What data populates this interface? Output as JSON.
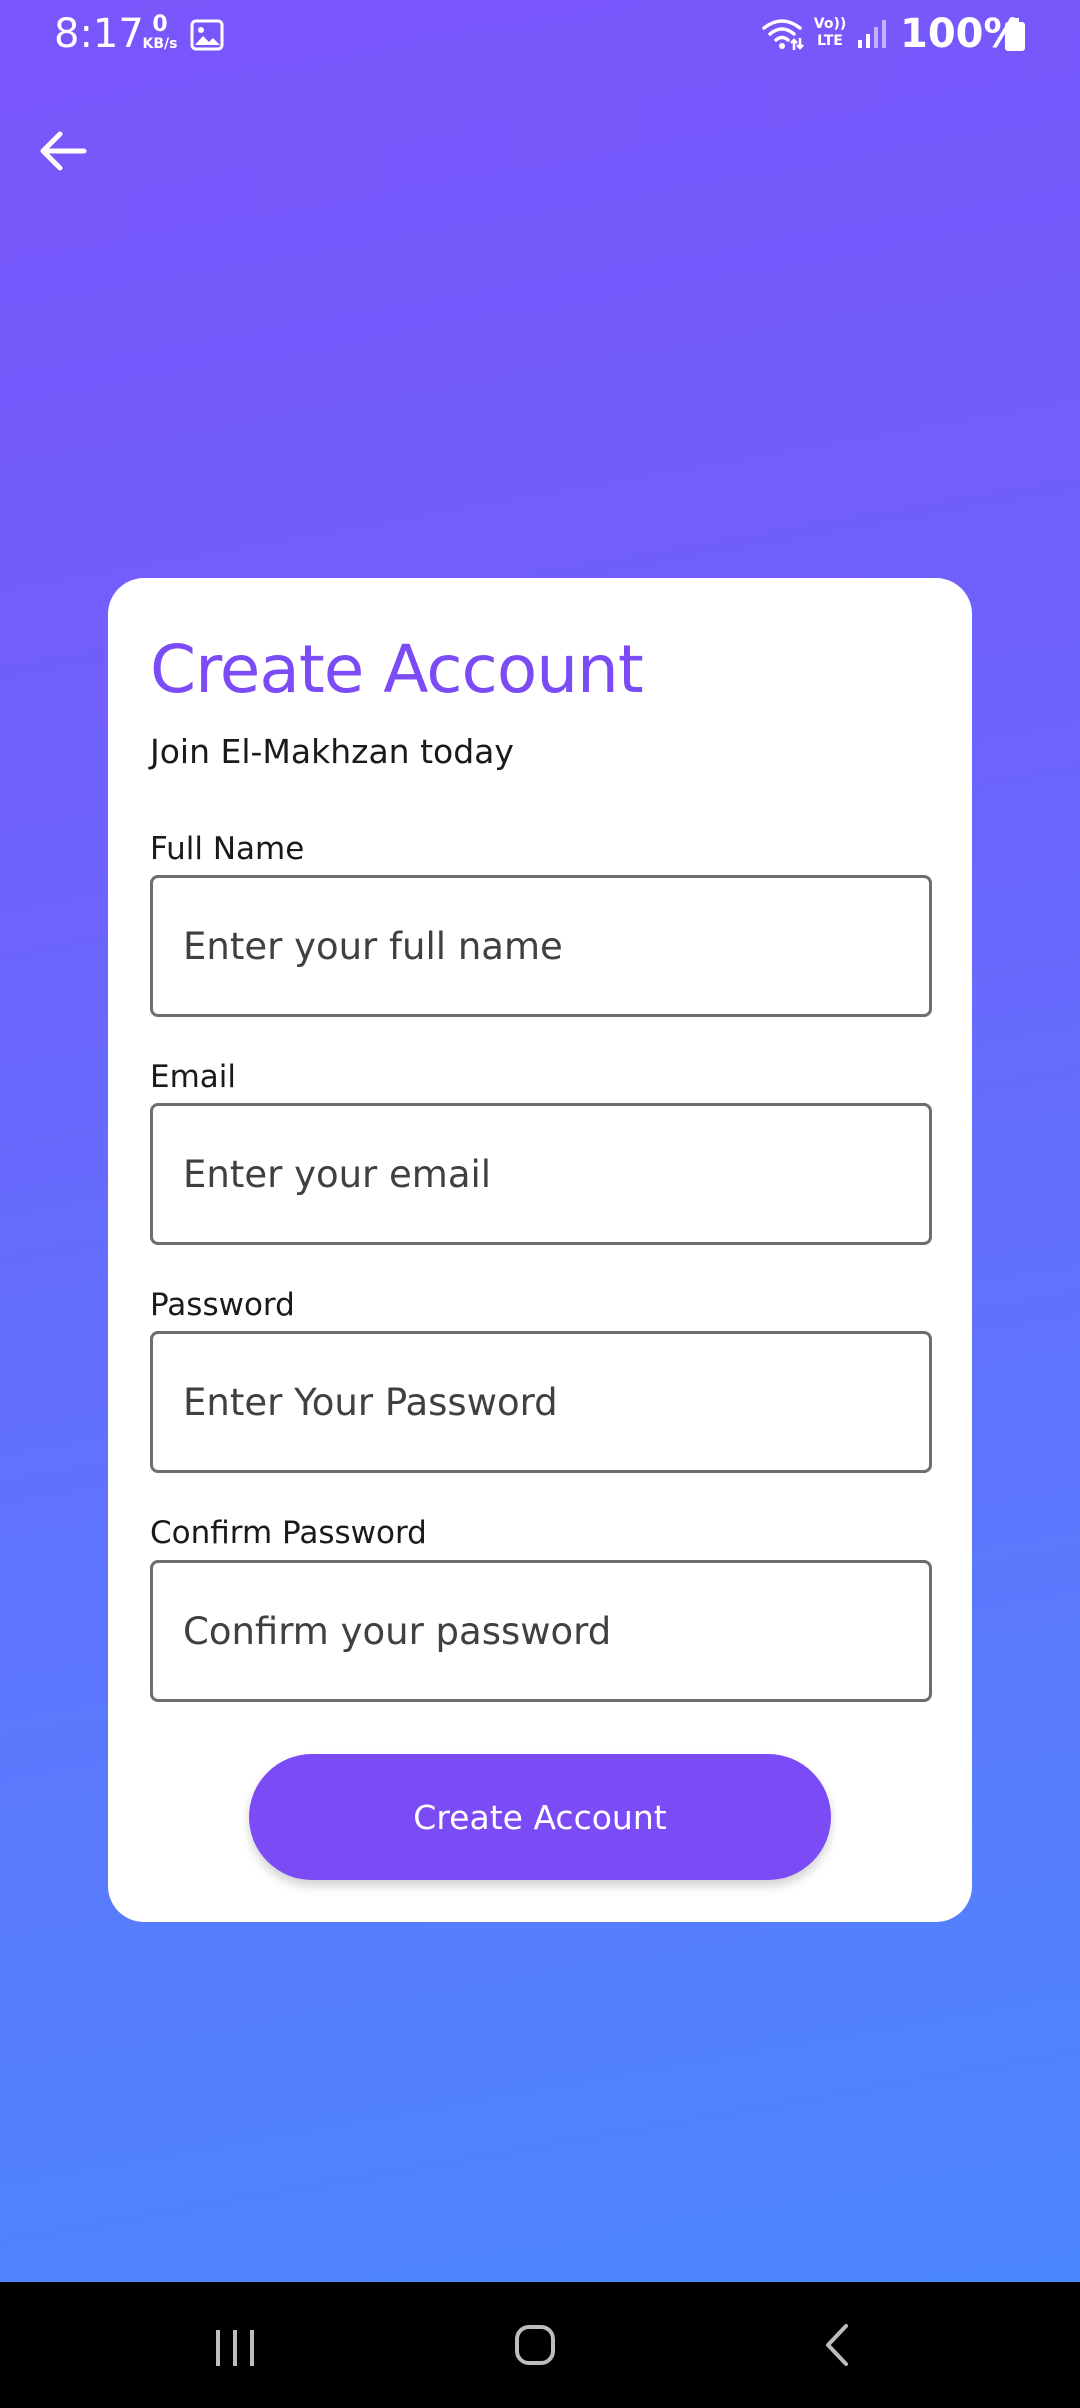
{
  "status_bar": {
    "time": "8:17",
    "net_speed_value": "0",
    "net_speed_unit": "KB/s",
    "volte_top": "Vo))",
    "volte_bottom": "LTE",
    "battery_percent": "100%"
  },
  "icons": {
    "back": "arrow-left-icon",
    "gallery": "image-icon",
    "wifi": "wifi-icon",
    "signal": "signal-icon",
    "battery": "battery-icon",
    "recents": "recents-icon",
    "home": "home-icon",
    "nav_back": "chevron-left-icon"
  },
  "form": {
    "title": "Create Account",
    "subtitle": "Join El-Makhzan today",
    "fields": [
      {
        "label": "Full Name",
        "placeholder": "Enter your full name",
        "value": ""
      },
      {
        "label": "Email",
        "placeholder": "Enter your email",
        "value": ""
      },
      {
        "label": "Password",
        "placeholder": "Enter Your Password",
        "value": ""
      },
      {
        "label": "Confirm Password",
        "placeholder": "Confirm your password",
        "value": ""
      }
    ],
    "submit_label": "Create Account"
  },
  "colors": {
    "accent": "#7b4cf6",
    "gradient_top": "#7a55fb",
    "gradient_bottom": "#4a8afd",
    "card": "#ffffff",
    "nav_bar": "#000000"
  }
}
